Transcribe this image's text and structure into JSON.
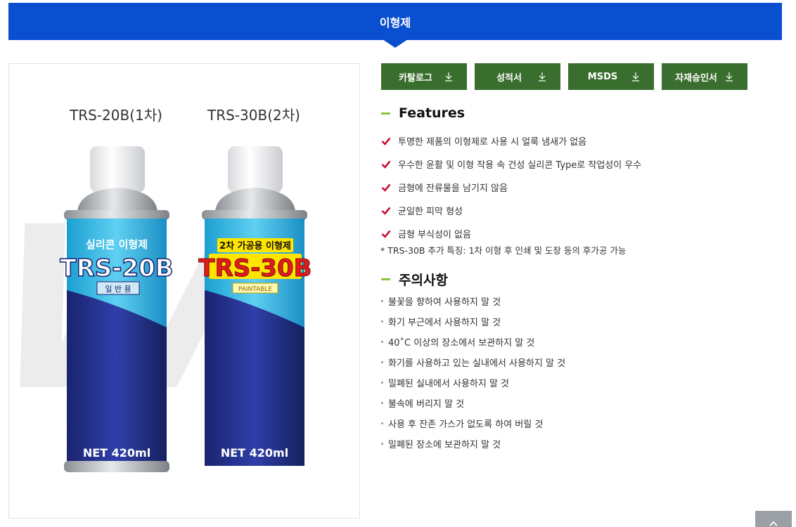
{
  "header": {
    "title": "이형제"
  },
  "product_image": {
    "left_label": "TRS-20B(1차)",
    "right_label": "TRS-30B(2차)",
    "left_can": {
      "top_text": "실리콘 이형제",
      "brand": "TRS-20B",
      "badge": "일 반 용",
      "net": "NET 420ml"
    },
    "right_can": {
      "top_text": "2차 가공용 이형제",
      "brand": "TRS-30B",
      "badge": "PAINTABLE",
      "net": "NET 420ml"
    }
  },
  "downloads": [
    {
      "label": "카탈로그",
      "icon": "download-icon"
    },
    {
      "label": "성적서",
      "icon": "download-icon"
    },
    {
      "label": "MSDS",
      "icon": "download-icon"
    },
    {
      "label": "자재승인서",
      "icon": "download-icon"
    }
  ],
  "features": {
    "title": "Features",
    "items": [
      "투명한 제품의 이형제로 사용 시 얼룩 냄새가 없음",
      "우수한 윤활 및 이형 작용 속 건성 실리콘 Type로 작업성이 우수",
      "금형에 잔류물을 남기지 않음",
      "균일한 피막 형성",
      "금형 부식성이 없음"
    ],
    "note": "* TRS-30B 추가 특징: 1차 이형 후 인쇄 및 도장 등의 후가공 가능"
  },
  "cautions": {
    "title": "주의사항",
    "items": [
      "불꽃을 향하여 사용하지 말 것",
      "화기 부근에서 사용하지 말 것",
      "40˚C 이상의 장소에서 보관하지 말 것",
      "화기를 사용하고 있는 실내에서 사용하지 말 것",
      "밀폐된 실내에서 사용하지 말 것",
      "불속에 버리지 말 것",
      "사용 후 잔존 가스가 없도록 하여 버릴 것",
      "밀폐된 장소에 보관하지 말 것"
    ]
  },
  "colors": {
    "header": "#0a4fcf",
    "download_button": "#3a6e2e",
    "check": "#c8102e",
    "accent_dash": "#8ac43f"
  }
}
